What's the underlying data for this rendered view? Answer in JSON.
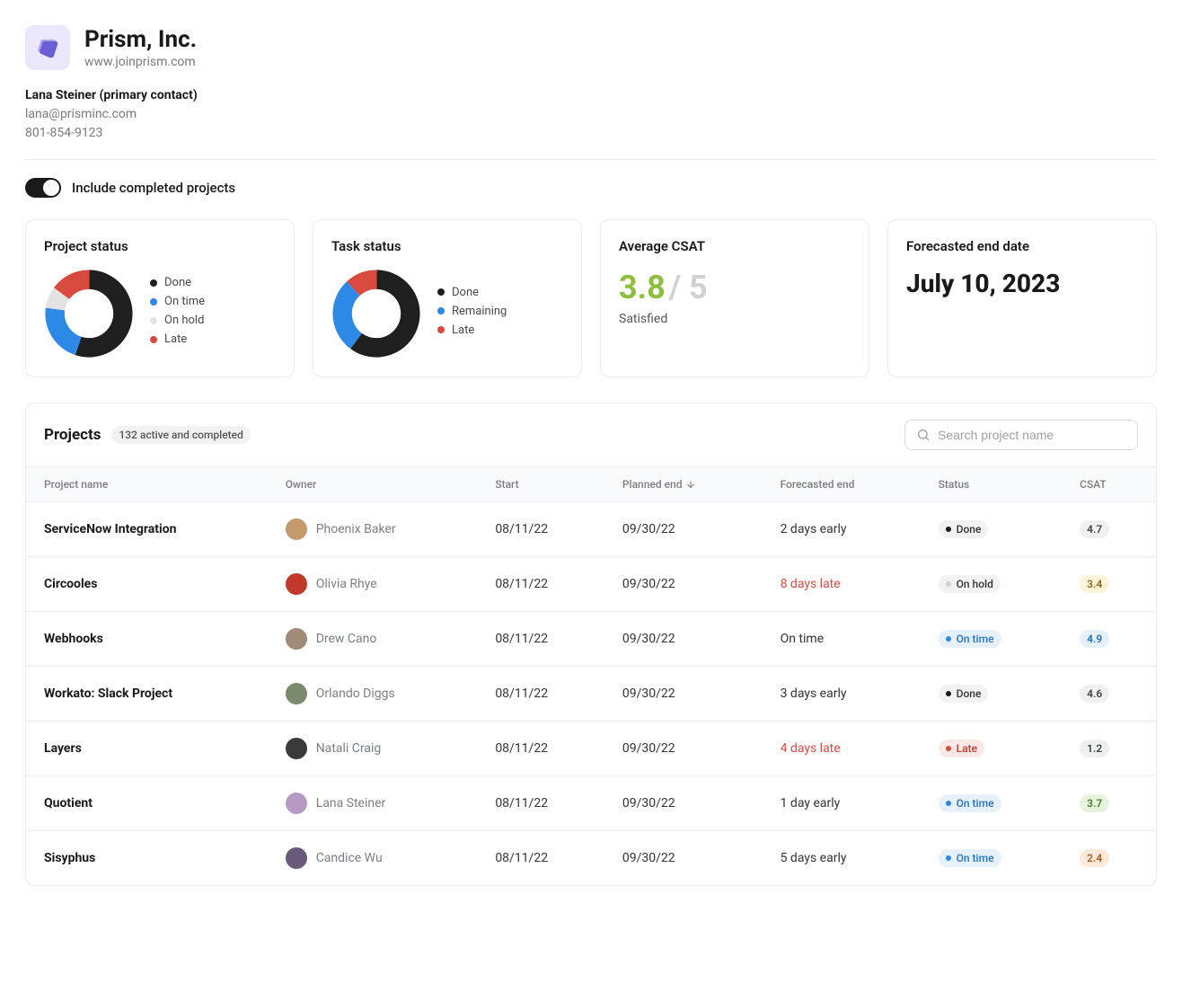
{
  "company": {
    "name": "Prism, Inc.",
    "url": "www.joinprism.com"
  },
  "contact": {
    "name": "Lana Steiner (primary contact)",
    "email": "lana@prisminc.com",
    "phone": "801-854-9123"
  },
  "toggle": {
    "label": "Include completed projects",
    "on": true
  },
  "cards": {
    "project_status": {
      "title": "Project status",
      "legend": [
        "Done",
        "On time",
        "On hold",
        "Late"
      ]
    },
    "task_status": {
      "title": "Task status",
      "legend": [
        "Done",
        "Remaining",
        "Late"
      ]
    },
    "csat": {
      "title": "Average CSAT",
      "value": "3.8",
      "max": "/ 5",
      "label": "Satisfied"
    },
    "forecast": {
      "title": "Forecasted end date",
      "value": "July 10, 2023"
    }
  },
  "chart_data": [
    {
      "type": "pie",
      "title": "Project status",
      "series": [
        {
          "name": "Done",
          "value": 55,
          "color": "#1f1f1f"
        },
        {
          "name": "On time",
          "value": 22,
          "color": "#2c8ae6"
        },
        {
          "name": "On hold",
          "value": 8,
          "color": "#e3e3e3"
        },
        {
          "name": "Late",
          "value": 15,
          "color": "#d84a3e"
        }
      ]
    },
    {
      "type": "pie",
      "title": "Task status",
      "series": [
        {
          "name": "Done",
          "value": 60,
          "color": "#1f1f1f"
        },
        {
          "name": "Remaining",
          "value": 28,
          "color": "#2c8ae6"
        },
        {
          "name": "Late",
          "value": 12,
          "color": "#d84a3e"
        }
      ]
    }
  ],
  "projects": {
    "title": "Projects",
    "count_label": "132 active and completed",
    "search_placeholder": "Search project name",
    "columns": [
      "Project name",
      "Owner",
      "Start",
      "Planned end",
      "Forecasted end",
      "Status",
      "CSAT"
    ],
    "rows": [
      {
        "name": "ServiceNow Integration",
        "owner": "Phoenix Baker",
        "avatar_bg": "#c49a6c",
        "start": "08/11/22",
        "planned": "09/30/22",
        "forecast": "2 days early",
        "late": false,
        "status": "Done",
        "status_class": "pill-done",
        "csat": "4.7",
        "csat_class": "b-gray"
      },
      {
        "name": "Circooles",
        "owner": "Olivia Rhye",
        "avatar_bg": "#c0392b",
        "start": "08/11/22",
        "planned": "09/30/22",
        "forecast": "8 days late",
        "late": true,
        "status": "On hold",
        "status_class": "pill-hold",
        "csat": "3.4",
        "csat_class": "b-yellow"
      },
      {
        "name": "Webhooks",
        "owner": "Drew Cano",
        "avatar_bg": "#a08a78",
        "start": "08/11/22",
        "planned": "09/30/22",
        "forecast": "On time",
        "late": false,
        "status": "On time",
        "status_class": "pill-ontime",
        "csat": "4.9",
        "csat_class": "b-blue"
      },
      {
        "name": "Workato: Slack Project",
        "owner": "Orlando Diggs",
        "avatar_bg": "#7a8a6c",
        "start": "08/11/22",
        "planned": "09/30/22",
        "forecast": "3 days early",
        "late": false,
        "status": "Done",
        "status_class": "pill-done",
        "csat": "4.6",
        "csat_class": "b-gray"
      },
      {
        "name": "Layers",
        "owner": "Natali Craig",
        "avatar_bg": "#3a3a3a",
        "start": "08/11/22",
        "planned": "09/30/22",
        "forecast": "4 days late",
        "late": true,
        "status": "Late",
        "status_class": "pill-late",
        "csat": "1.2",
        "csat_class": "b-gray"
      },
      {
        "name": "Quotient",
        "owner": "Lana Steiner",
        "avatar_bg": "#b79ac4",
        "start": "08/11/22",
        "planned": "09/30/22",
        "forecast": "1 day early",
        "late": false,
        "status": "On time",
        "status_class": "pill-ontime",
        "csat": "3.7",
        "csat_class": "b-green"
      },
      {
        "name": "Sisyphus",
        "owner": "Candice Wu",
        "avatar_bg": "#6a5a7a",
        "start": "08/11/22",
        "planned": "09/30/22",
        "forecast": "5 days early",
        "late": false,
        "status": "On time",
        "status_class": "pill-ontime",
        "csat": "2.4",
        "csat_class": "b-orange"
      }
    ]
  },
  "colors": {
    "done": "#1f1f1f",
    "ontime": "#2c8ae6",
    "hold": "#e3e3e3",
    "late": "#d84a3e",
    "remaining": "#2c8ae6"
  }
}
